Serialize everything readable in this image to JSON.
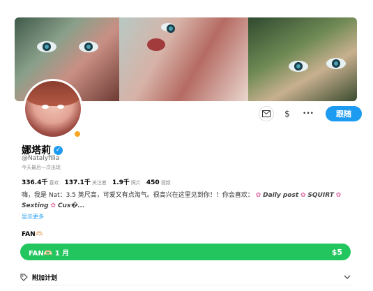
{
  "profile": {
    "name": "娜塔莉",
    "handle": "@Natalyfilia",
    "last_seen": "今天最后一次出现",
    "online_color": "#f5a623"
  },
  "actions": {
    "message_icon": "mail-icon",
    "tip_icon": "$",
    "more_icon": "•••",
    "follow_label": "跟随"
  },
  "stats": [
    {
      "value": "336.4千",
      "label": "喜欢"
    },
    {
      "value": "137.1千",
      "label": "关注者"
    },
    {
      "value": "1.9千",
      "label": "照片"
    },
    {
      "value": "450",
      "label": "视频"
    }
  ],
  "bio": {
    "line1_text": "嗨，我是 Nat：3.5 英尺高，可爱又有点淘气。很高兴在这里见到你！！你会喜欢：",
    "tag1": "Daily post",
    "tag2": "SQUIRT",
    "tag3": "Sexting",
    "tag4": "Cus�...",
    "show_more": "显示更多"
  },
  "subscription": {
    "title": "FAN🫶🏻",
    "plan_label": "FAN🫶🏻 1 月",
    "price": "$5"
  },
  "extra": {
    "label": "附加计划"
  }
}
